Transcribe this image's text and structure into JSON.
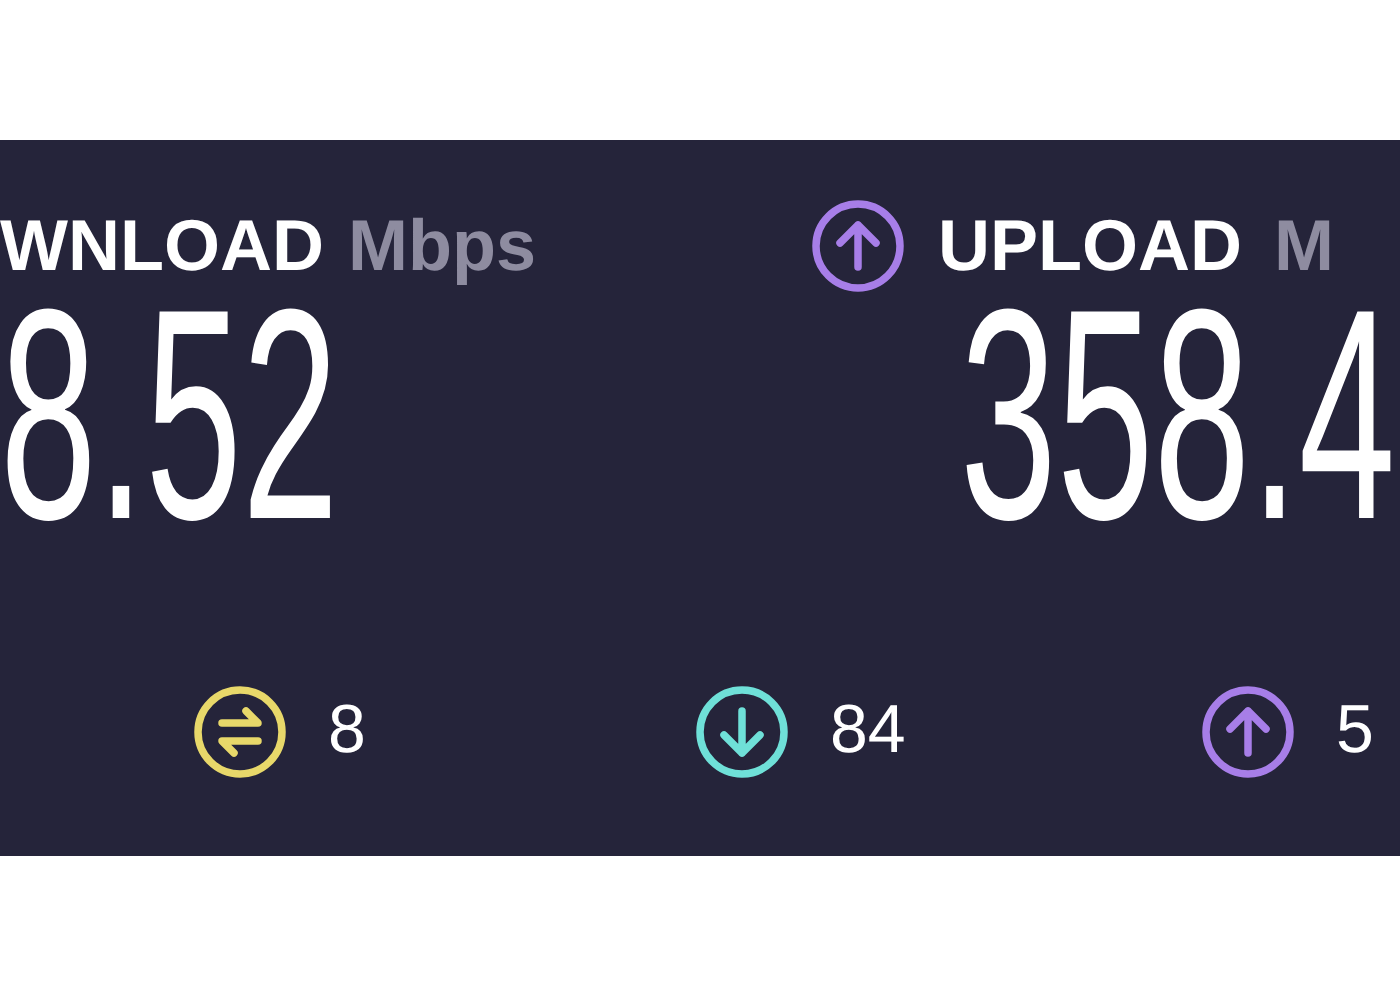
{
  "download": {
    "label": "WNLOAD",
    "unit": "Mbps",
    "value": "8.52"
  },
  "upload": {
    "label": "UPLOAD",
    "unit": "M",
    "value": "358.4"
  },
  "stats": [
    {
      "kind": "ping",
      "value": "8",
      "color": "#e8d86a"
    },
    {
      "kind": "down",
      "value": "84",
      "color": "#6fe0d8"
    },
    {
      "kind": "up",
      "value": "5",
      "color": "#a77ee8"
    }
  ]
}
